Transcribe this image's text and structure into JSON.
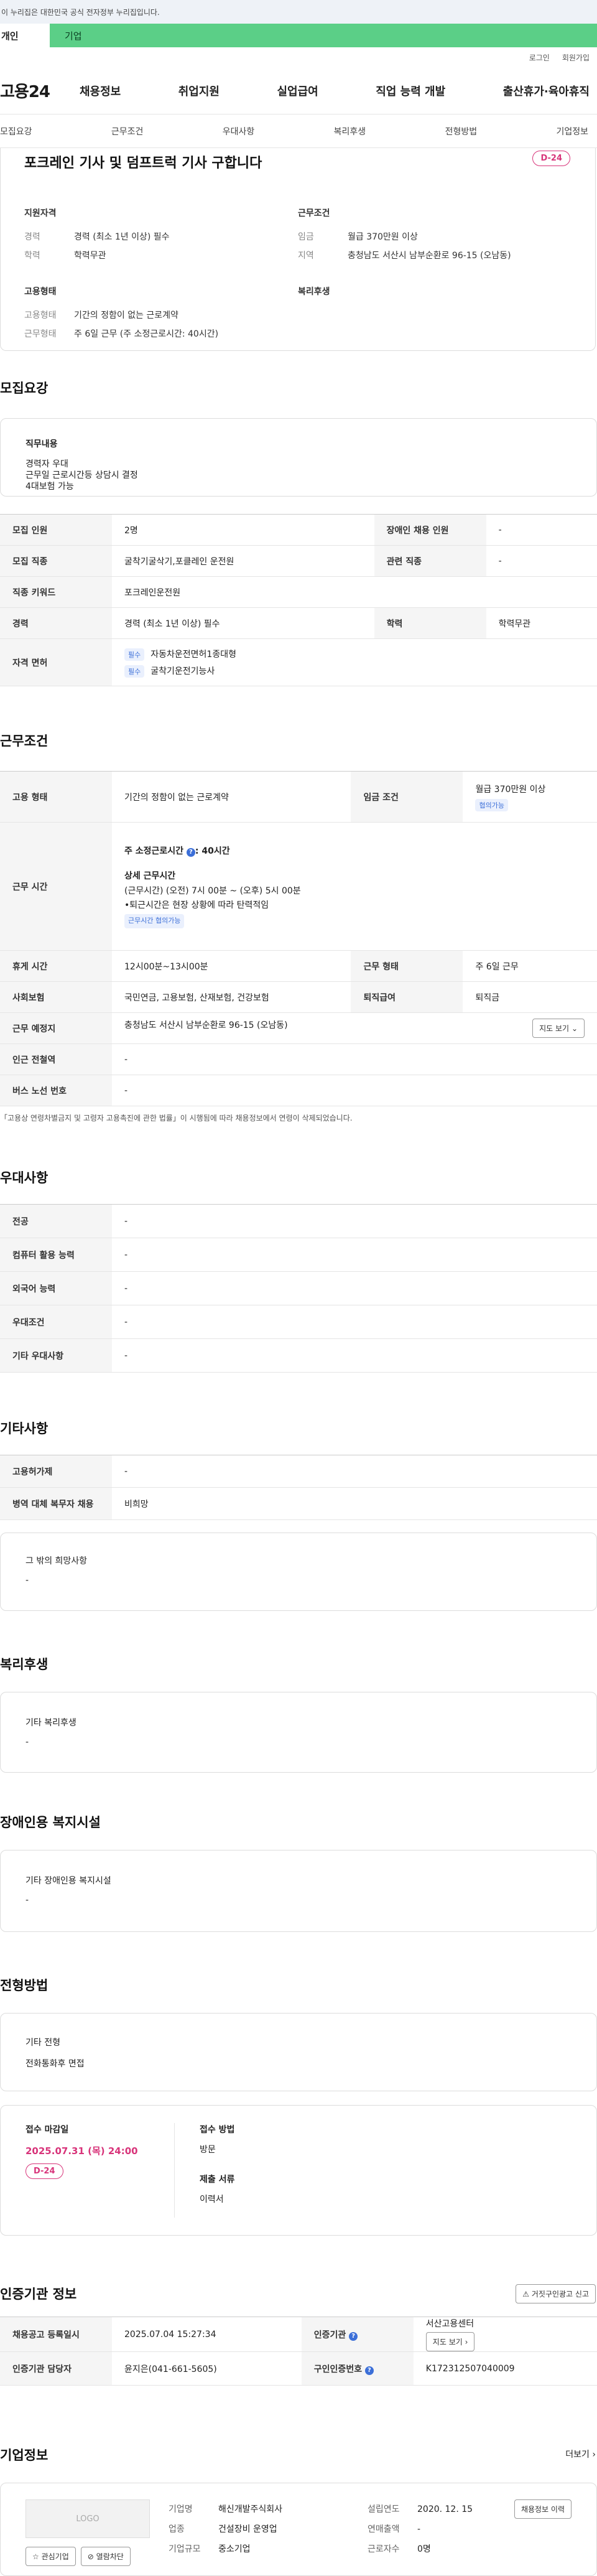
{
  "gov_banner": "이 누리집은 대한민국 공식 전자정부 누리집입니다.",
  "user_tabs": {
    "individual": "개인",
    "company": "기업"
  },
  "util_links": {
    "login": "로그인",
    "signup": "회원가입"
  },
  "site_logo": "고용24",
  "gnb": [
    "채용정보",
    "취업지원",
    "실업급여",
    "직업 능력 개발",
    "출산휴가·육아휴직"
  ],
  "subnav": [
    "모집요강",
    "근무조건",
    "우대사항",
    "복리후생",
    "전형방법",
    "기업정보"
  ],
  "job": {
    "title": "포크레인 기사 및 덤프트럭 기사 구합니다",
    "dday": "D-24",
    "qual_title": "지원자격",
    "qual": [
      {
        "k": "경력",
        "v": "경력 (최소 1년 이상) 필수"
      },
      {
        "k": "학력",
        "v": "학력무관"
      }
    ],
    "cond_title": "근무조건",
    "cond": [
      {
        "k": "임금",
        "v": "월급 370만원 이상"
      },
      {
        "k": "지역",
        "v": "충청남도 서산시 남부순환로 96-15 (오남동)"
      }
    ],
    "emp_title": "고용형태",
    "emp": [
      {
        "k": "고용형태",
        "v": "기간의 정함이 없는 근로계약"
      },
      {
        "k": "근무형태",
        "v": "주 6일 근무 (주 소정근로시간: 40시간)"
      }
    ],
    "welfare_title": "복리후생"
  },
  "recruit": {
    "title": "모집요강",
    "duty_label": "직무내용",
    "duty_lines": [
      "경력자 우대",
      "근무일 근로시간등 상담시 결정",
      "4대보험 가능"
    ],
    "rows": [
      {
        "k1": "모집 인원",
        "v1": "2명",
        "k2": "장애인 채용 인원",
        "v2": "-"
      },
      {
        "k1": "모집 직종",
        "v1": "굴착기굴삭기,포클레인 운전원",
        "k2": "관련 직종",
        "v2": "-"
      },
      {
        "k1": "직종 키워드",
        "v1": "포크레인운전원"
      },
      {
        "k1": "경력",
        "v1": "경력 (최소 1년 이상) 필수",
        "k2": "학력",
        "v2": "학력무관"
      }
    ],
    "license_label": "자격 면허",
    "licenses": [
      {
        "tag": "필수",
        "name": "자동차운전면허1종대형"
      },
      {
        "tag": "필수",
        "name": "굴착기운전기능사"
      }
    ]
  },
  "workcond": {
    "title": "근무조건",
    "emp_type_k": "고용 형태",
    "emp_type_v": "기간의 정함이 없는 근로계약",
    "wage_k": "임금 조건",
    "wage_v": "월급 370만원 이상",
    "wage_tag": "협의가능",
    "hours_k": "근무 시간",
    "hours_main": "주 소정근로시간",
    "hours_value": "40시간",
    "hours_detail_title": "상세 근무시간",
    "hours_detail1": "(근무시간) (오전) 7시 00분 ~ (오후) 5시 00분",
    "hours_detail2": "•퇴근시간은 현장 상황에 따라 탄력적임",
    "hours_tag": "근무시간 협의가능",
    "rest_k": "휴게 시간",
    "rest_v": "12시00분~13시00분",
    "form_k": "근무 형태",
    "form_v": "주 6일 근무",
    "ins_k": "사회보험",
    "ins_v": "국민연금, 고용보험, 산재보험, 건강보험",
    "sev_k": "퇴직급여",
    "sev_v": "퇴직금",
    "loc_k": "근무 예정지",
    "loc_v": "충청남도 서산시 남부순환로 96-15 (오남동)",
    "map_btn": "지도 보기",
    "subway_k": "인근 전철역",
    "subway_v": "-",
    "bus_k": "버스 노선 번호",
    "bus_v": "-",
    "note": "「고용상 연령차별금지 및 고령자 고용촉진에 관한 법률」이 시행됨에 따라 채용정보에서 연령이 삭제되었습니다."
  },
  "pref": {
    "title": "우대사항",
    "rows": [
      {
        "k": "전공",
        "v": "-"
      },
      {
        "k": "컴퓨터 활용 능력",
        "v": "-"
      },
      {
        "k": "외국어 능력",
        "v": "-"
      },
      {
        "k": "우대조건",
        "v": "-"
      },
      {
        "k": "기타 우대사항",
        "v": "-"
      }
    ]
  },
  "etc": {
    "title": "기타사항",
    "rows": [
      {
        "k": "고용허가제",
        "v": "-"
      },
      {
        "k": "병역 대체 복무자 채용",
        "v": "비희망"
      }
    ],
    "other_label": "그 밖의 희망사항",
    "other_value": "-"
  },
  "welfare": {
    "title": "복리후생",
    "label": "기타 복리후생",
    "value": "-"
  },
  "disabled": {
    "title": "장애인용 복지시설",
    "label": "기타 장애인용 복지시설",
    "value": "-"
  },
  "screening": {
    "title": "전형방법",
    "label": "기타 전형",
    "value": "전화통화후 면접",
    "deadline_label": "접수 마감일",
    "deadline": "2025.07.31 (목) 24:00",
    "dday": "D-24",
    "method_label": "접수 방법",
    "method": "방문",
    "docs_label": "제출 서류",
    "docs": "이력서"
  },
  "cert": {
    "title": "인증기관 정보",
    "report_btn": "거짓구인광고 신고",
    "reg_k": "채용공고 등록일시",
    "reg_v": "2025.07.04 15:27:34",
    "org_k": "인증기관",
    "org_v": "서산고용센터",
    "map_btn": "지도 보기",
    "mgr_k": "인증기관 담당자",
    "mgr_v": "윤지은(041-661-5605)",
    "no_k": "구인인증번호",
    "no_v": "K172312507040009"
  },
  "company": {
    "title": "기업정보",
    "more": "더보기",
    "logo": "LOGO",
    "interest_btn": "관심기업",
    "block_btn": "열람차단",
    "rows": [
      {
        "k1": "기업명",
        "v1": "해신개발주식회사",
        "k2": "설립연도",
        "v2": "2020. 12. 15"
      },
      {
        "k1": "업종",
        "v1": "건설장비 운영업",
        "k2": "연매출액",
        "v2": "-"
      },
      {
        "k1": "기업규모",
        "v1": "중소기업",
        "k2": "근로자수",
        "v2": "0명"
      }
    ],
    "jobs_btn": "채용정보 이력"
  }
}
